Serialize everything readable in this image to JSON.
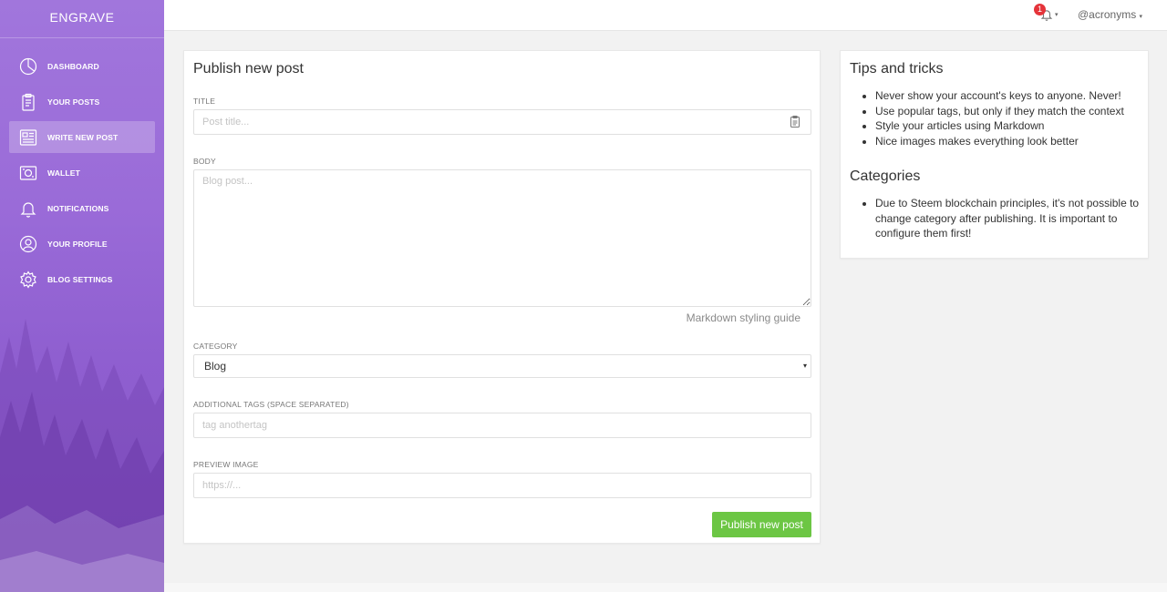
{
  "sidebar": {
    "brand": "ENGRAVE",
    "items": [
      {
        "label": "DASHBOARD",
        "icon": "pie-chart-icon",
        "active": false
      },
      {
        "label": "YOUR POSTS",
        "icon": "clipboard-icon",
        "active": false
      },
      {
        "label": "WRITE NEW POST",
        "icon": "newspaper-icon",
        "active": true
      },
      {
        "label": "WALLET",
        "icon": "wallet-icon",
        "active": false
      },
      {
        "label": "NOTIFICATIONS",
        "icon": "bell-icon",
        "active": false
      },
      {
        "label": "YOUR PROFILE",
        "icon": "user-circle-icon",
        "active": false
      },
      {
        "label": "BLOG SETTINGS",
        "icon": "gear-icon",
        "active": false
      }
    ]
  },
  "topbar": {
    "notification_count": "1",
    "username": "@acronyms",
    "caret": "▾"
  },
  "post_form": {
    "title": "Publish new post",
    "title_label": "TITLE",
    "title_placeholder": "Post title...",
    "title_value": "",
    "body_label": "BODY",
    "body_placeholder": "Blog post...",
    "body_value": "",
    "markdown_link": "Markdown styling guide",
    "category_label": "CATEGORY",
    "category_value": "Blog",
    "tags_label": "ADDITIONAL TAGS (SPACE SEPARATED)",
    "tags_placeholder": "tag anothertag",
    "tags_value": "",
    "preview_label": "PREVIEW IMAGE",
    "preview_placeholder": "https://...",
    "preview_value": "",
    "submit_label": "Publish new post"
  },
  "tips": {
    "title": "Tips and tricks",
    "items": [
      "Never show your account's keys to anyone. Never!",
      "Use popular tags, but only if they match the context",
      "Style your articles using Markdown",
      "Nice images makes everything look better"
    ],
    "categories_title": "Categories",
    "categories_items": [
      "Due to Steem blockchain principles, it's not possible to change category after publishing. It is important to configure them first!"
    ]
  },
  "colors": {
    "sidebar_purple": "#9a6bd8",
    "publish_green": "#6cc644",
    "badge_red": "#e5343a"
  }
}
